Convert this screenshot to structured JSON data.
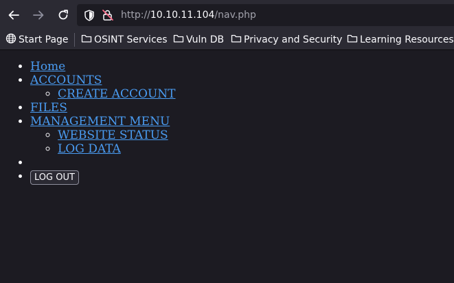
{
  "browser": {
    "icons": {
      "back": "arrow-left-icon",
      "forward": "arrow-right-icon",
      "reload": "reload-icon",
      "tracking_protection": "shield-icon",
      "connection": "insecure-lock-icon"
    },
    "url": {
      "scheme": "http://",
      "host": "10.10.11.104",
      "path": "/nav.php"
    }
  },
  "bookmarks": [
    {
      "label": "Start Page",
      "icon": "globe-icon"
    },
    {
      "label": "OSINT Services",
      "icon": "folder-icon"
    },
    {
      "label": "Vuln DB",
      "icon": "folder-icon"
    },
    {
      "label": "Privacy and Security",
      "icon": "folder-icon"
    },
    {
      "label": "Learning Resources",
      "icon": "folder-icon"
    }
  ],
  "nav": {
    "home": "Home",
    "accounts": "ACCOUNTS",
    "create_account": "CREATE ACCOUNT",
    "files": "FILES",
    "management_menu": "MANAGEMENT MENU",
    "website_status": "WEBSITE STATUS",
    "log_data": "LOG DATA",
    "logout_button": "LOG OUT"
  },
  "colors": {
    "page_background": "#1c1b22",
    "toolbar_background": "#2b2a33",
    "link": "#4a9cf2",
    "text": "#fbfbfe"
  }
}
